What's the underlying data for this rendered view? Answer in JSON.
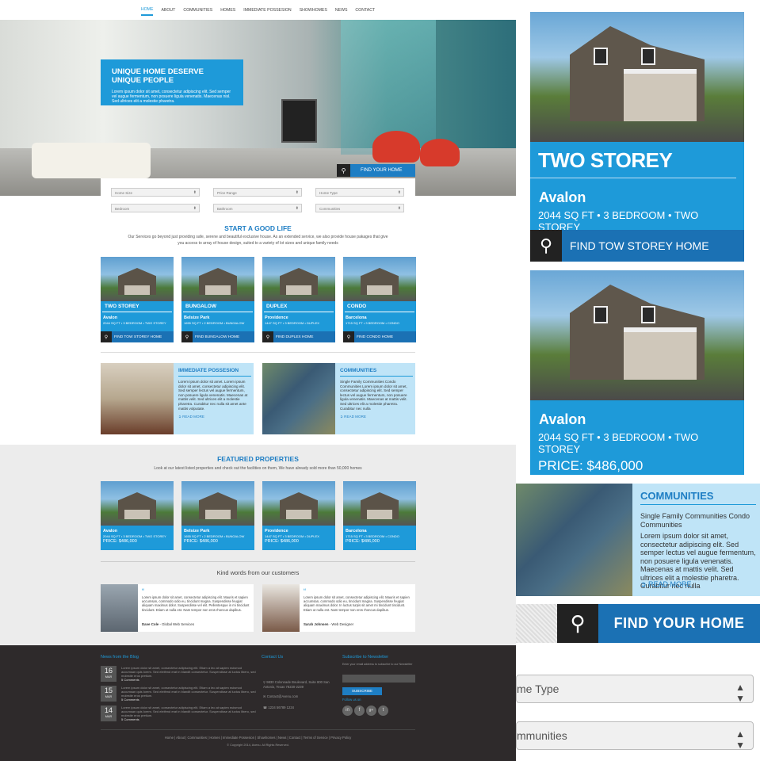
{
  "nav": [
    "HOME",
    "ABOUT",
    "COMMUNITIES",
    "HOMES",
    "IMMEDIATE POSSESION",
    "SHOWHOMES",
    "NEWS",
    "CONTACT"
  ],
  "hero": {
    "title": "UNIQUE HOME DESERVE UNIQUE PEOPLE",
    "text": "Lorem ipsum dolor sit amet, consectetur adipiscing elit. Sed semper vel augue fermentum, non posuere ligula venenatis. Maecenas nisl. Sed ultrices elit a molestie pharetra.",
    "button": "FIND YOUR HOME"
  },
  "search": {
    "fields": [
      "Home Size",
      "Price Range",
      "Home Type",
      "Bedroom",
      "Bathroom",
      "Communities"
    ]
  },
  "intro": {
    "title": "START A GOOD LIFE",
    "text": "Our Services go beyond just providing safe, serene and beautiful exclusive house. As an extended service, we also provide house pakages that give you access to array of house design, suited to a variety of lot sizes and unique family needs"
  },
  "types": [
    {
      "type": "TWO STOREY",
      "name": "Avalon",
      "spec": "2044 SQ FT • 3 BEDROOM • TWO STOREY",
      "button": "FIND TOW STOREY HOME"
    },
    {
      "type": "BUNGALOW",
      "name": "Belsize Park",
      "spec": "1655 SQ FT • 2 BEDROOM • BUNGALOW",
      "button": "FIND BUNGALOW HOME"
    },
    {
      "type": "DUPLEX",
      "name": "Providence",
      "spec": "1447 SQ FT • 3 BEDROOM • DUPLEX",
      "button": "FIND DUPLEX HOME"
    },
    {
      "type": "CONDO",
      "name": "Barcelona",
      "spec": "1715 SQ FT • 3 BEDROOM • CONDO",
      "button": "FIND CONDO HOME"
    }
  ],
  "promos": [
    {
      "title": "IMMEDIATE POSSESION",
      "text": "Lorem ipsum dolor sit amet. Lorem ipsum dolor sit amet, consectetur adipiscing elit. Sed semper lectus vel augue fermentum, non posuere ligula venenatis. Maecenas at mattis velit. Sed ultrices elit a molestie pharetra. Curabitur nec nulla sit amet ante mattis volputate.",
      "link": "READ MORE"
    },
    {
      "title": "COMMUNITIES",
      "text": "Single Family Communities Condo Communities Lorem ipsum dolor sit amet, consectetur adipiscing elit. Sed semper lectus vel augue fermentum, non posuere ligula venenatis. Maecenas at mattis velit. Sed ultrices elit a molestie pharetra. Curabitur nec nulla",
      "link": "READ MORE"
    }
  ],
  "featured": {
    "title": "FEATURED PROPERTIES",
    "text": "Look at our latest listed properties and check out the facilities on them, We have already sold more than 50,000 homes",
    "items": [
      {
        "name": "Avalon",
        "spec": "2044 SQ FT • 3 BEDROOM • TWO STOREY",
        "price": "PRICE: $486,000"
      },
      {
        "name": "Belsize Park",
        "spec": "1655 SQ FT • 2 BEDROOM • BUNGALOW",
        "price": "PRICE: $486,000"
      },
      {
        "name": "Providence",
        "spec": "1447 SQ FT • 3 BEDROOM • DUPLEX",
        "price": "PRICE: $486,000"
      },
      {
        "name": "Barcelona",
        "spec": "1715 SQ FT • 3 BEDROOM • CONDO",
        "price": "PRICE: $486,000"
      }
    ]
  },
  "testimonials": {
    "title": "Kind words from our customers",
    "items": [
      {
        "text": "Lorem ipsum dolor sit amet, consectetur adipiscing elit. Mauris et sapien accumsan, commodo odio eu, tincidunt magna. Suspendisse feugiat aliquam maximus dolor. Suspendisse vel elit. Pellentesque in mi tincidunt tincidunt. Etiam ut nulla est. Nam tempor non eros rhoncus dapibus.",
        "author": "Dave Cole",
        "company": " - Global Web Services"
      },
      {
        "text": "Lorem ipsum dolor sit amet, consectetur adipiscing elit. Mauris et sapien accumsan, commodo odio eu, tincidunt magna. Suspendisse feugiat aliquam maximus dolor. In luctus turpis sit amet mi tincidunt tincidunt. Etiam ut nulla est. Nam tempor non eros rhoncus dapibus.",
        "author": "Sarah Johnsen",
        "company": " - Web Designer"
      }
    ]
  },
  "footer": {
    "news_title": "News from the Blog",
    "news": [
      {
        "day": "16",
        "mon": "MAR",
        "text": "Lorem ipsum dolor sit amet, consectetur adipiscing elit. Etiam a leo at sapien euismod accumsan quis lorem. Sed eleifend erat in blandit consectetur. Suspendisse at luctus libero, sed molestie eros pretium.",
        "comments": "5 Comments"
      },
      {
        "day": "15",
        "mon": "MAR",
        "text": "Lorem ipsum dolor sit amet, consectetur adipiscing elit. Etiam a leo at sapien euismod accumsan quis lorem. Sed eleifend erat in blandit consectetur. Suspendisse at luctus libero, sed molestie eros pretium.",
        "comments": "5 Comments"
      },
      {
        "day": "14",
        "mon": "MAR",
        "text": "Lorem ipsum dolor sit amet, consectetur adipiscing elit. Etiam a leo at sapien euismod accumsan quis lorem. Sed eleifend erat in blandit consectetur. Suspendisse at luctus libero, sed molestie eros pretium.",
        "comments": "5 Comments"
      }
    ],
    "contact_title": "Contact Us",
    "address": "9830 Colonnade Boulevard, Suite 800 San Antonio, Texas 78230-2239",
    "email": "Contact@Avenu.com",
    "phone": "1234 56789 1234",
    "subscribe_title": "Subscribe to Newsletter",
    "subscribe_text": "Enter your email address to subscribe to our Newsletter",
    "subscribe_button": "SUBSCRIBE",
    "follow": "Follow us on",
    "links": "Home | About | Communities | Homes | Immediate Possesion | Showhomes | News | Contact | Terms of Service | Privacy Policy",
    "copyright": "© Copyright 2014, Avenu. All Rights Reserved."
  },
  "zoom": {
    "card1": {
      "type": "TWO STOREY",
      "name": "Avalon",
      "spec": "2044 SQ FT • 3 BEDROOM • TWO STOREY",
      "button": "FIND TOW STOREY HOME"
    },
    "card2": {
      "name": "Avalon",
      "spec": "2044 SQ FT • 3 BEDROOM • TWO STOREY",
      "price": "PRICE: $486,000"
    },
    "communities": {
      "title": "COMMUNITIES",
      "sub": "Single Family Communities Condo Communities",
      "text": "Lorem ipsum dolor sit amet, consectetur adipiscing elit. Sed semper lectus vel augue fermentum, non posuere ligula venenatis. Maecenas at mattis velit. Sed ultrices elit a molestie pharetra. Curabitur nec nulla",
      "link": "READ MORE"
    },
    "find_button": "FIND YOUR HOME",
    "select1": "me Type",
    "select2": "mmunities"
  }
}
